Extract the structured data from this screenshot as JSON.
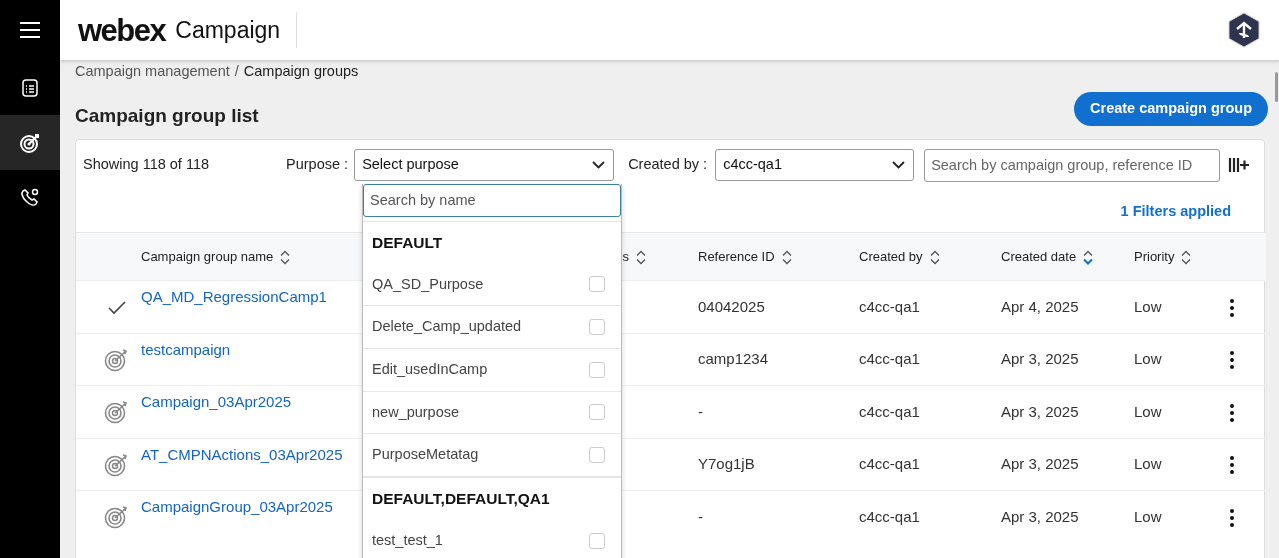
{
  "header": {
    "brand": "webex",
    "product": "Campaign"
  },
  "sidebar": {
    "items": [
      {
        "kind": "menu",
        "selected": false
      },
      {
        "kind": "list",
        "selected": false
      },
      {
        "kind": "target",
        "selected": true
      },
      {
        "kind": "phone",
        "selected": false
      }
    ]
  },
  "breadcrumb": {
    "separator": "/",
    "items": [
      {
        "label": "Campaign management",
        "current": false
      },
      {
        "label": "Campaign groups",
        "current": true
      }
    ]
  },
  "page_title": "Campaign group list",
  "create_button": "Create campaign group",
  "filters": {
    "showing": "Showing 118 of 118",
    "purpose_label": "Purpose :",
    "purpose_value": "Select purpose",
    "created_by_label": "Created by :",
    "created_by_value": "c4cc-qa1",
    "search_placeholder": "Search by campaign group, reference ID",
    "applied": "1 Filters applied"
  },
  "table": {
    "columns": [
      {
        "label": "Campaign group name",
        "sorted": false
      },
      {
        "label": "s",
        "sorted": false
      },
      {
        "label": "Reference ID",
        "sorted": false
      },
      {
        "label": "Created by",
        "sorted": false
      },
      {
        "label": "Created date",
        "sorted": true
      },
      {
        "label": "Priority",
        "sorted": false
      }
    ],
    "rows": [
      {
        "kind": "check",
        "name": "QA_MD_RegressionCamp1",
        "reference_id": "04042025",
        "created_by": "c4cc-qa1",
        "created_date": "Apr 4, 2025",
        "priority": "Low"
      },
      {
        "kind": "target",
        "name": "testcampaign",
        "reference_id": "camp1234",
        "created_by": "c4cc-qa1",
        "created_date": "Apr 3, 2025",
        "priority": "Low"
      },
      {
        "kind": "target",
        "name": "Campaign_03Apr2025",
        "reference_id": "-",
        "created_by": "c4cc-qa1",
        "created_date": "Apr 3, 2025",
        "priority": "Low"
      },
      {
        "kind": "target",
        "name": "AT_CMPNActions_03Apr2025",
        "reference_id": "Y7og1jB",
        "created_by": "c4cc-qa1",
        "created_date": "Apr 3, 2025",
        "priority": "Low"
      },
      {
        "kind": "target",
        "name": "CampaignGroup_03Apr2025",
        "reference_id": "-",
        "created_by": "c4cc-qa1",
        "created_date": "Apr 3, 2025",
        "priority": "Low"
      }
    ]
  },
  "purpose_dropdown": {
    "search_placeholder": "Search by name",
    "groups": [
      {
        "name": "DEFAULT",
        "items": [
          {
            "label": "QA_SD_Purpose",
            "checked": false
          },
          {
            "label": "Delete_Camp_updated",
            "checked": false
          },
          {
            "label": "Edit_usedInCamp",
            "checked": false
          },
          {
            "label": "new_purpose",
            "checked": false
          },
          {
            "label": "PurposeMetatag",
            "checked": false
          }
        ]
      },
      {
        "name": "DEFAULT,DEFAULT,QA1",
        "items": [
          {
            "label": "test_test_1",
            "checked": false
          }
        ]
      }
    ]
  }
}
